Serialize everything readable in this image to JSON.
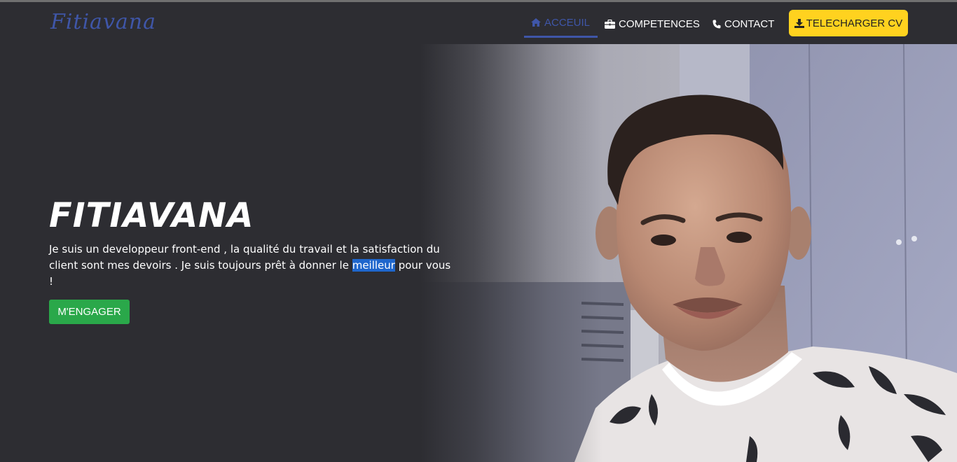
{
  "brand": {
    "name": "Fitiavana"
  },
  "nav": {
    "items": [
      {
        "label": "ACCEUIL",
        "icon": "home-icon",
        "active": true
      },
      {
        "label": "COMPETENCES",
        "icon": "briefcase-icon",
        "active": false
      },
      {
        "label": "CONTACT",
        "icon": "phone-icon",
        "active": false
      }
    ],
    "cv_button": {
      "label": "TELECHARGER CV",
      "icon": "download-icon"
    }
  },
  "hero": {
    "title": "FITIAVANA",
    "text_before": "Je suis un developpeur front-end , la qualité du travail et la satisfaction du client sont mes devoirs . Je suis toujours prêt à donner le ",
    "text_highlight": "meilleur",
    "text_after": " pour vous !",
    "button_label": "M'ENGAGER",
    "photo": "portrait-photo"
  },
  "colors": {
    "background": "#2d2d32",
    "accent": "#3f56a8",
    "cv_button": "#ffd21f",
    "engage_button": "#2aa84a",
    "selection": "#1e66cc"
  }
}
